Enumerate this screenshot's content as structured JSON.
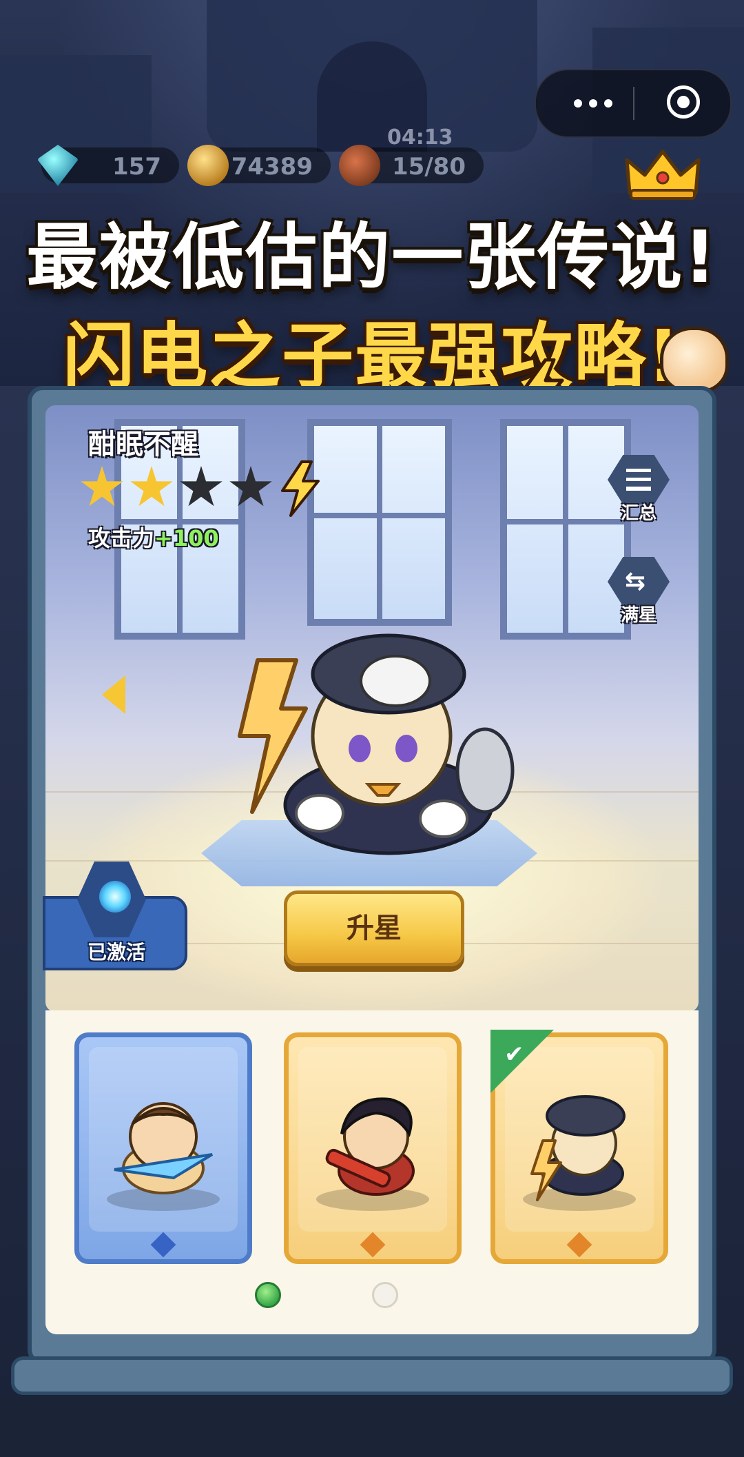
{
  "topbar": {
    "more_icon": "more-dots-icon",
    "target_icon": "target-icon"
  },
  "resources": {
    "gems": "157",
    "coins": "74389",
    "timer": "04:13",
    "stamina": "15/80"
  },
  "headline": {
    "line1": "最被低估的一张传说!",
    "line2": "闪电之子最强攻略!"
  },
  "hero": {
    "name": "酣眠不醒",
    "stars_on": 2,
    "stars_total": 4,
    "attack_label": "攻击力",
    "attack_bonus": "+100"
  },
  "side_buttons": {
    "summary": "汇总",
    "max_star": "满星"
  },
  "activated_label": "已激活",
  "upgrade_label": "升星",
  "roster": {
    "cards": [
      {
        "rarity": "blue",
        "selected": false
      },
      {
        "rarity": "gold",
        "selected": false
      },
      {
        "rarity": "gold",
        "selected": true
      }
    ],
    "page": 1,
    "pages": 2
  },
  "colors": {
    "accent_gold": "#f6c847",
    "headline_yellow": "#ffd84a",
    "attack_green": "#8ef25c",
    "card_blue": "#4f7cc8",
    "card_gold": "#e5a838"
  }
}
